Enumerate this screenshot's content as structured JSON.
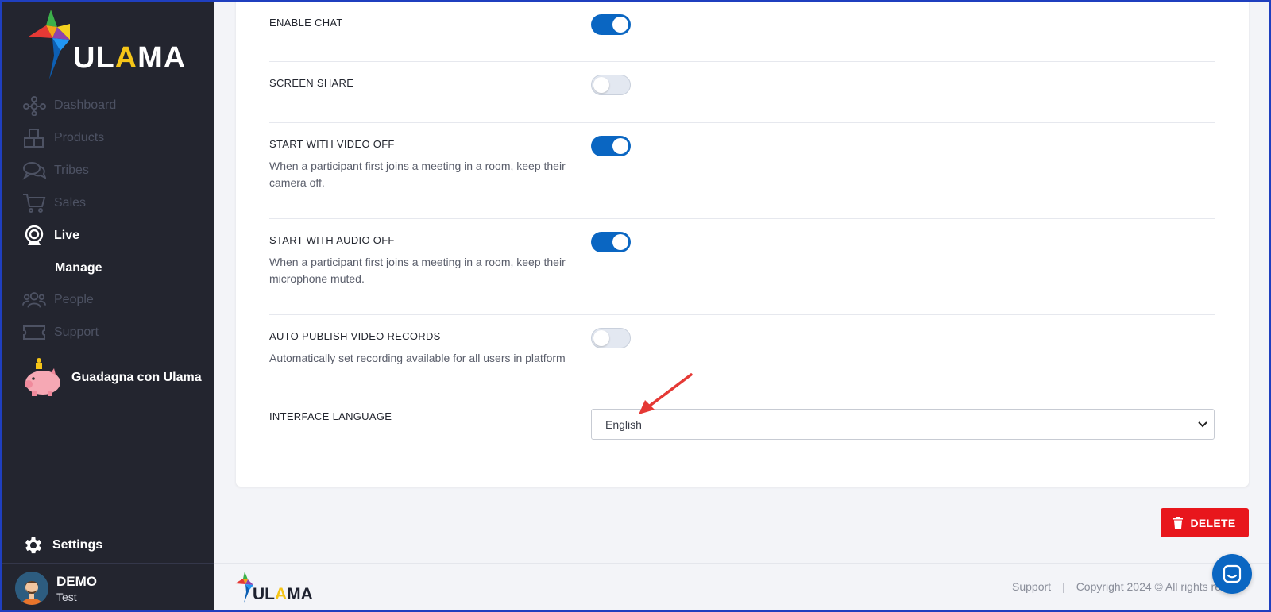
{
  "brand": {
    "name_part1": "UL",
    "name_accent": "A",
    "name_part2": "MA"
  },
  "sidebar": {
    "items": [
      {
        "label": "Dashboard",
        "icon": "network-icon",
        "active": false
      },
      {
        "label": "Products",
        "icon": "boxes-icon",
        "active": false
      },
      {
        "label": "Tribes",
        "icon": "chat-bubbles-icon",
        "active": false
      },
      {
        "label": "Sales",
        "icon": "cart-icon",
        "active": false
      },
      {
        "label": "Live",
        "icon": "webcam-icon",
        "active": true
      },
      {
        "label": "People",
        "icon": "people-icon",
        "active": false
      },
      {
        "label": "Support",
        "icon": "ticket-icon",
        "active": false
      }
    ],
    "sub_item": "Manage",
    "promo": "Guadagna con Ulama",
    "settings": "Settings",
    "user": {
      "name": "DEMO",
      "role": "Test"
    }
  },
  "settings_rows": [
    {
      "label": "ENABLE CHAT",
      "enabled": true,
      "description": ""
    },
    {
      "label": "SCREEN SHARE",
      "enabled": false,
      "description": ""
    },
    {
      "label": "START WITH VIDEO OFF",
      "enabled": true,
      "description_line1": "When a participant first joins a meeting in a room, keep their",
      "description_line2": "camera off."
    },
    {
      "label": "START WITH AUDIO OFF",
      "enabled": true,
      "description_line1": "When a participant first joins a meeting in a room, keep their",
      "description_line2": "microphone muted."
    },
    {
      "label": "AUTO PUBLISH VIDEO RECORDS",
      "enabled": false,
      "description_line1": "Automatically set recording available for all users in platform",
      "description_line2": ""
    }
  ],
  "language": {
    "label": "INTERFACE LANGUAGE",
    "value": "English"
  },
  "actions": {
    "delete_label": "DELETE"
  },
  "footer": {
    "support": "Support",
    "separator": "|",
    "copyright": "Copyright 2024 © All rights re"
  },
  "colors": {
    "accent": "#0a66c2",
    "danger": "#e8161c",
    "sidebar": "#23252f",
    "annotation": "#e53935"
  }
}
